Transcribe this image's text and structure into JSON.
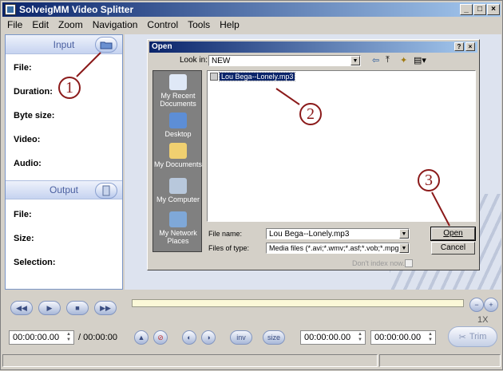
{
  "app": {
    "title": "SolveigMM Video Splitter"
  },
  "menu": [
    "File",
    "Edit",
    "Zoom",
    "Navigation",
    "Control",
    "Tools",
    "Help"
  ],
  "input_panel": {
    "title": "Input",
    "fields": [
      "File:",
      "Duration:",
      "Byte size:",
      "Video:",
      "Audio:"
    ]
  },
  "output_panel": {
    "title": "Output",
    "fields": [
      "File:",
      "Size:",
      "Selection:"
    ]
  },
  "dialog": {
    "title": "Open",
    "look_in_label": "Look in:",
    "look_in_value": "NEW",
    "places": [
      "My Recent Documents",
      "Desktop",
      "My Documents",
      "My Computer",
      "My Network Places"
    ],
    "files": [
      "Lou Bega--Lonely.mp3"
    ],
    "file_name_label": "File name:",
    "file_name_value": "Lou Bega--Lonely.mp3",
    "file_type_label": "Files of type:",
    "file_type_value": "Media files (*.avi;*.wmv;*.asf;*.vob;*.mpg;*.mpeg",
    "dont_index_label": "Don't index now.",
    "open_label": "Open",
    "cancel_label": "Cancel"
  },
  "annotations": [
    "1",
    "2",
    "3"
  ],
  "transport": {
    "time_start": "00:00:00.00",
    "time_total": "/ 00:00:00",
    "time_a": "00:00:00.00",
    "time_b": "00:00:00.00",
    "inv_label": "inv",
    "size_label": "size",
    "zoom_label": "1X",
    "trim_label": "Trim"
  }
}
